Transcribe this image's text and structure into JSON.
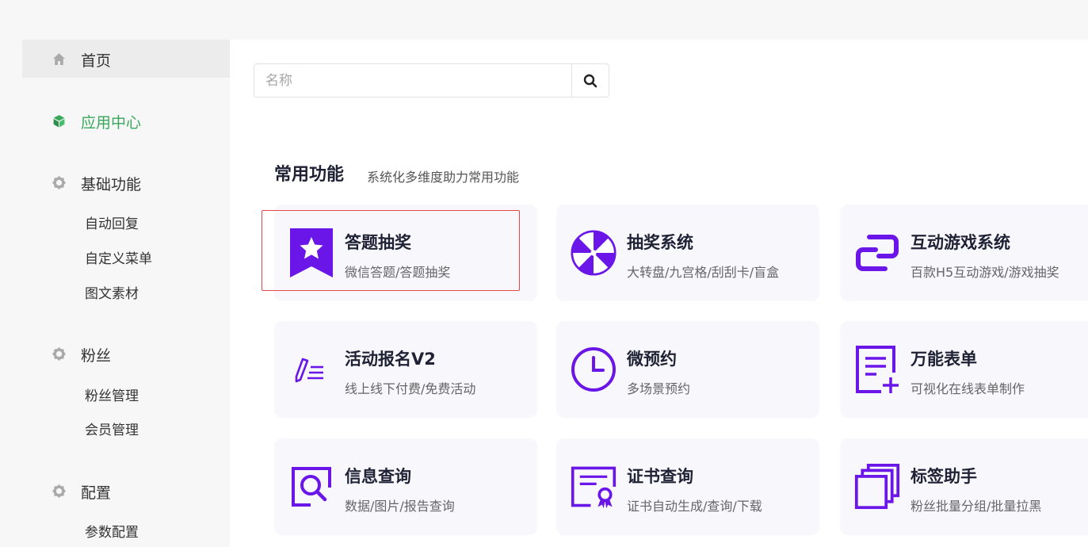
{
  "sidebar": {
    "home": "首页",
    "app_center": "应用中心",
    "basic": {
      "label": "基础功能",
      "items": [
        "自动回复",
        "自定义菜单",
        "图文素材"
      ]
    },
    "fans": {
      "label": "粉丝",
      "items": [
        "粉丝管理",
        "会员管理"
      ]
    },
    "config": {
      "label": "配置",
      "items": [
        "参数配置"
      ]
    }
  },
  "search": {
    "placeholder": "名称",
    "value": ""
  },
  "section": {
    "title": "常用功能",
    "subtitle": "系统化多维度助力常用功能"
  },
  "cards": [
    {
      "title": "答题抽奖",
      "desc": "微信答题/答题抽奖",
      "icon": "star-bookmark-icon"
    },
    {
      "title": "抽奖系统",
      "desc": "大转盘/九宫格/刮刮卡/盲盒",
      "icon": "wheel-icon"
    },
    {
      "title": "互动游戏系统",
      "desc": "百款H5互动游戏/游戏抽奖",
      "icon": "link-game-icon"
    },
    {
      "title": "活动报名V2",
      "desc": "线上线下付费/免费活动",
      "icon": "pen-list-icon"
    },
    {
      "title": "微预约",
      "desc": "多场景预约",
      "icon": "clock-icon"
    },
    {
      "title": "万能表单",
      "desc": "可视化在线表单制作",
      "icon": "form-add-icon"
    },
    {
      "title": "信息查询",
      "desc": "数据/图片/报告查询",
      "icon": "search-doc-icon"
    },
    {
      "title": "证书查询",
      "desc": "证书自动生成/查询/下载",
      "icon": "certificate-icon"
    },
    {
      "title": "标签助手",
      "desc": "粉丝批量分组/批量拉黑",
      "icon": "stack-icon"
    }
  ],
  "colors": {
    "accent_purple": "#6a16e8",
    "active_green": "#3aa75c",
    "highlight_red": "#e24a4a"
  }
}
